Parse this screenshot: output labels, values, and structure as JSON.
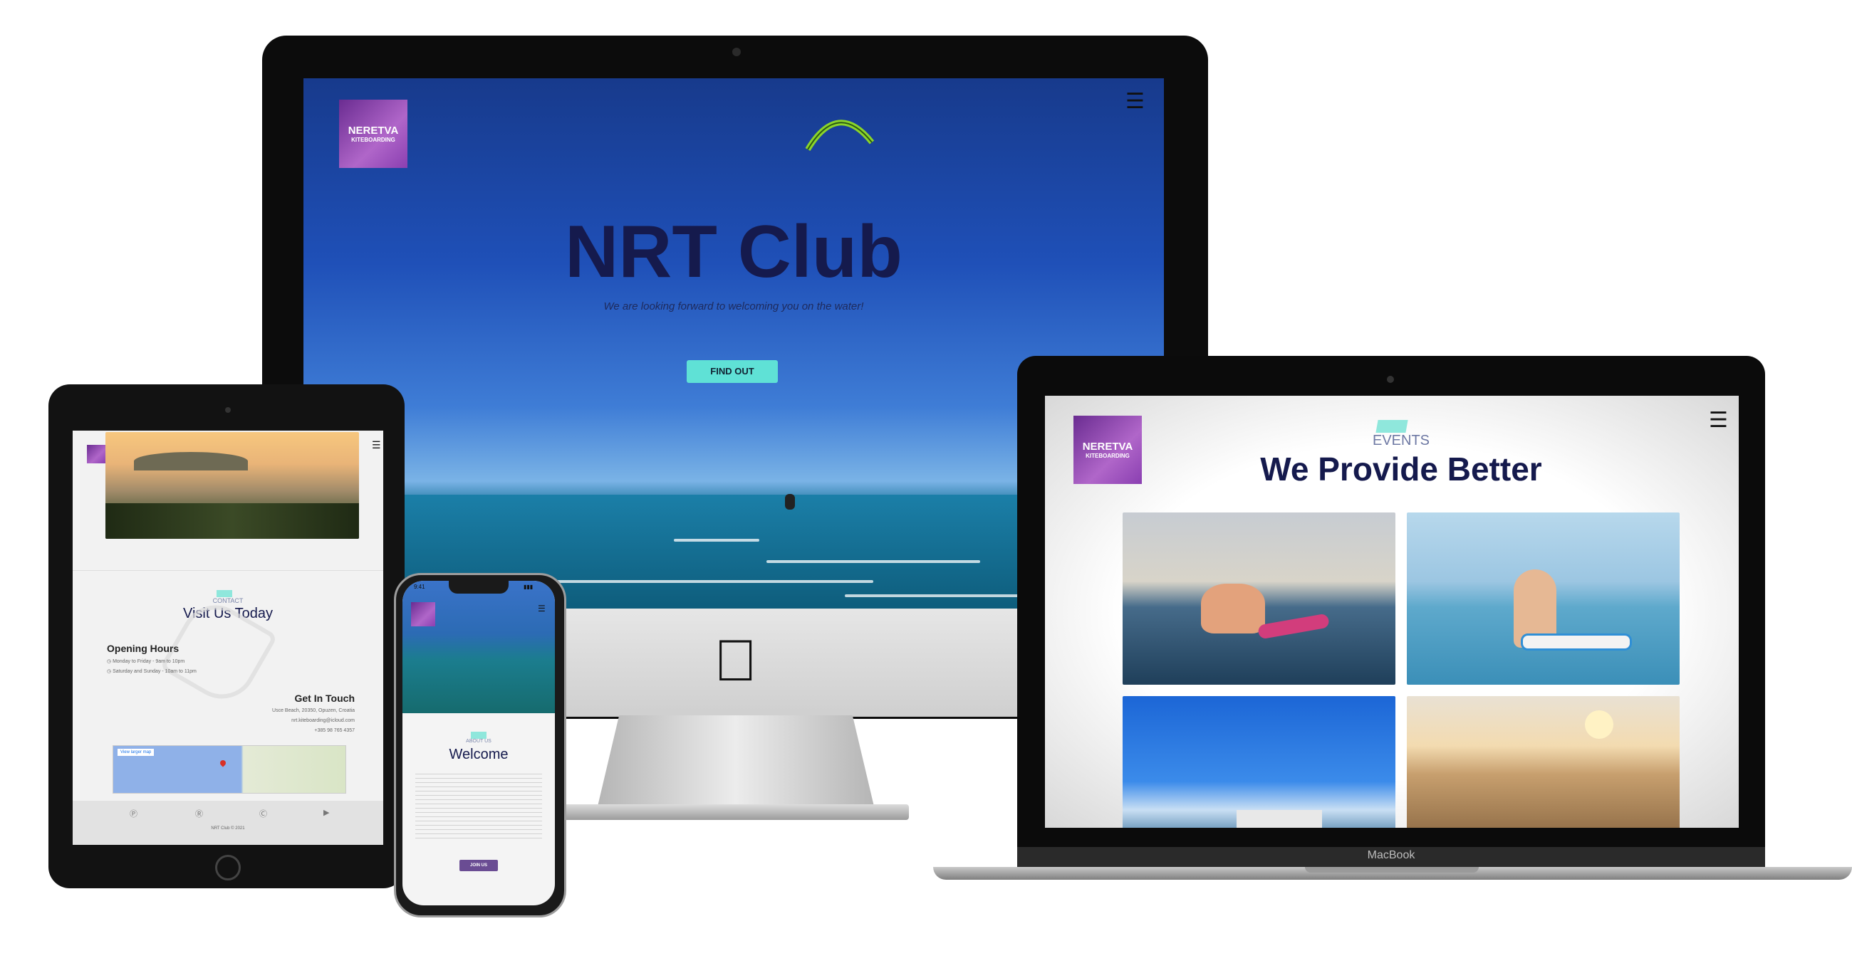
{
  "imac": {
    "logo_line1": "NERETVA",
    "logo_line2": "KITEBOARDING",
    "title": "NRT Club",
    "subtitle": "We are looking forward to welcoming you on the water!",
    "button": "FIND OUT",
    "menu_icon": "hamburger-icon"
  },
  "laptop": {
    "logo_line1": "NERETVA",
    "logo_line2": "KITEBOARDING",
    "section_label": "EVENTS",
    "heading": "We Provide Better",
    "brand_label": "MacBook",
    "menu_icon": "hamburger-icon"
  },
  "ipad": {
    "contact_label": "CONTACT",
    "heading": "Visit Us Today",
    "hours_title": "Opening Hours",
    "hours_weekday": "Monday to Friday - 9am to 10pm",
    "hours_weekend": "Saturday and Sunday - 10am to 11pm",
    "touch_title": "Get In Touch",
    "address": "Usce Beach, 20350, Opuzen, Croatia",
    "email": "nrt.kiteboarding@icloud.com",
    "phone": "+385 98 765 4357",
    "map_button": "View larger map",
    "footer": "NRT Club © 2021",
    "social_icons": [
      "facebook-icon",
      "twitter-icon",
      "instagram-icon",
      "youtube-icon"
    ]
  },
  "phone": {
    "time": "9:41",
    "about_label": "ABOUT US",
    "heading": "Welcome",
    "button": "JOIN US"
  },
  "colors": {
    "navy_title": "#151a4d",
    "teal_button": "#5fe1d6",
    "purple_logo": "#8a3fb1",
    "purple_button": "#6a4c93"
  }
}
